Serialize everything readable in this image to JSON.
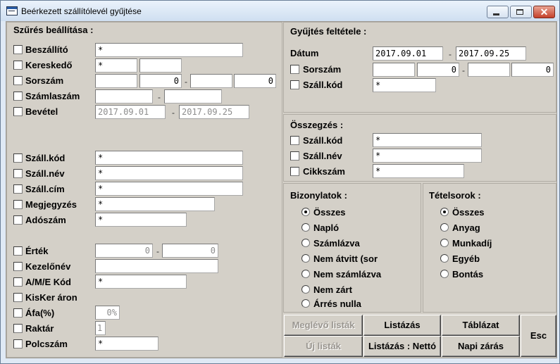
{
  "window": {
    "title": "Beérkezett szállítólevél gyűjtése",
    "close_glyph": "✕"
  },
  "filter": {
    "title": "Szűrés beállítása :",
    "supplier": {
      "label": "Beszállító",
      "value": "*"
    },
    "trader": {
      "label": "Kereskedő",
      "value1": "*",
      "value2": ""
    },
    "serial": {
      "label": "Sorszám",
      "from_prefix": "",
      "from": "0",
      "to_prefix": "",
      "to": "0"
    },
    "invoice_no": {
      "label": "Számlaszám",
      "from": "",
      "to": ""
    },
    "revenue": {
      "label": "Bevétel",
      "from": "2017.09.01",
      "to": "2017.09.25"
    },
    "ship_code": {
      "label": "Száll.kód",
      "value": "*"
    },
    "ship_name": {
      "label": "Száll.név",
      "value": "*"
    },
    "ship_addr": {
      "label": "Száll.cím",
      "value": "*"
    },
    "note": {
      "label": "Megjegyzés",
      "value": "*"
    },
    "tax_no": {
      "label": "Adószám",
      "value": "*"
    },
    "amount": {
      "label": "Érték",
      "from": "0",
      "to": "0"
    },
    "operator": {
      "label": "Kezelőnév",
      "value": ""
    },
    "ame_code": {
      "label": "A/M/E Kód",
      "value": "*"
    },
    "kisker": {
      "label": "KisKer áron"
    },
    "vat": {
      "label": "Áfa(%)",
      "value": "0%"
    },
    "warehouse": {
      "label": "Raktár",
      "value": "1"
    },
    "shelf": {
      "label": "Polcszám",
      "value": "*"
    },
    "dash": "-"
  },
  "collect": {
    "title": "Gyűjtés feltétele :",
    "date": {
      "label": "Dátum",
      "from": "2017.09.01",
      "to": "2017.09.25"
    },
    "serial": {
      "label": "Sorszám",
      "from_prefix": "",
      "from": "0",
      "to_prefix": "",
      "to": "0"
    },
    "ship_code": {
      "label": "Száll.kód",
      "value": "*"
    }
  },
  "summary": {
    "title": "Összegzés :",
    "ship_code": {
      "label": "Száll.kód",
      "value": "*"
    },
    "ship_name": {
      "label": "Száll.név",
      "value": "*"
    },
    "item_no": {
      "label": "Cikkszám",
      "value": "*"
    }
  },
  "documents": {
    "title": "Bizonylatok :",
    "options": [
      "Összes",
      "Napló",
      "Számlázva",
      "Nem átvitt (sor",
      "Nem számlázva",
      "Nem zárt",
      "Árrés nulla"
    ]
  },
  "lines": {
    "title": "Tételsorok :",
    "options": [
      "Összes",
      "Anyag",
      "Munkadíj",
      "Egyéb",
      "Bontás"
    ]
  },
  "buttons": {
    "existing_lists": "Meglévő listák",
    "listing": "Listázás",
    "table": "Táblázat",
    "new_lists": "Új listák",
    "listing_net": "Listázás : Nettó",
    "daily_close": "Napi zárás",
    "esc": "Esc"
  }
}
